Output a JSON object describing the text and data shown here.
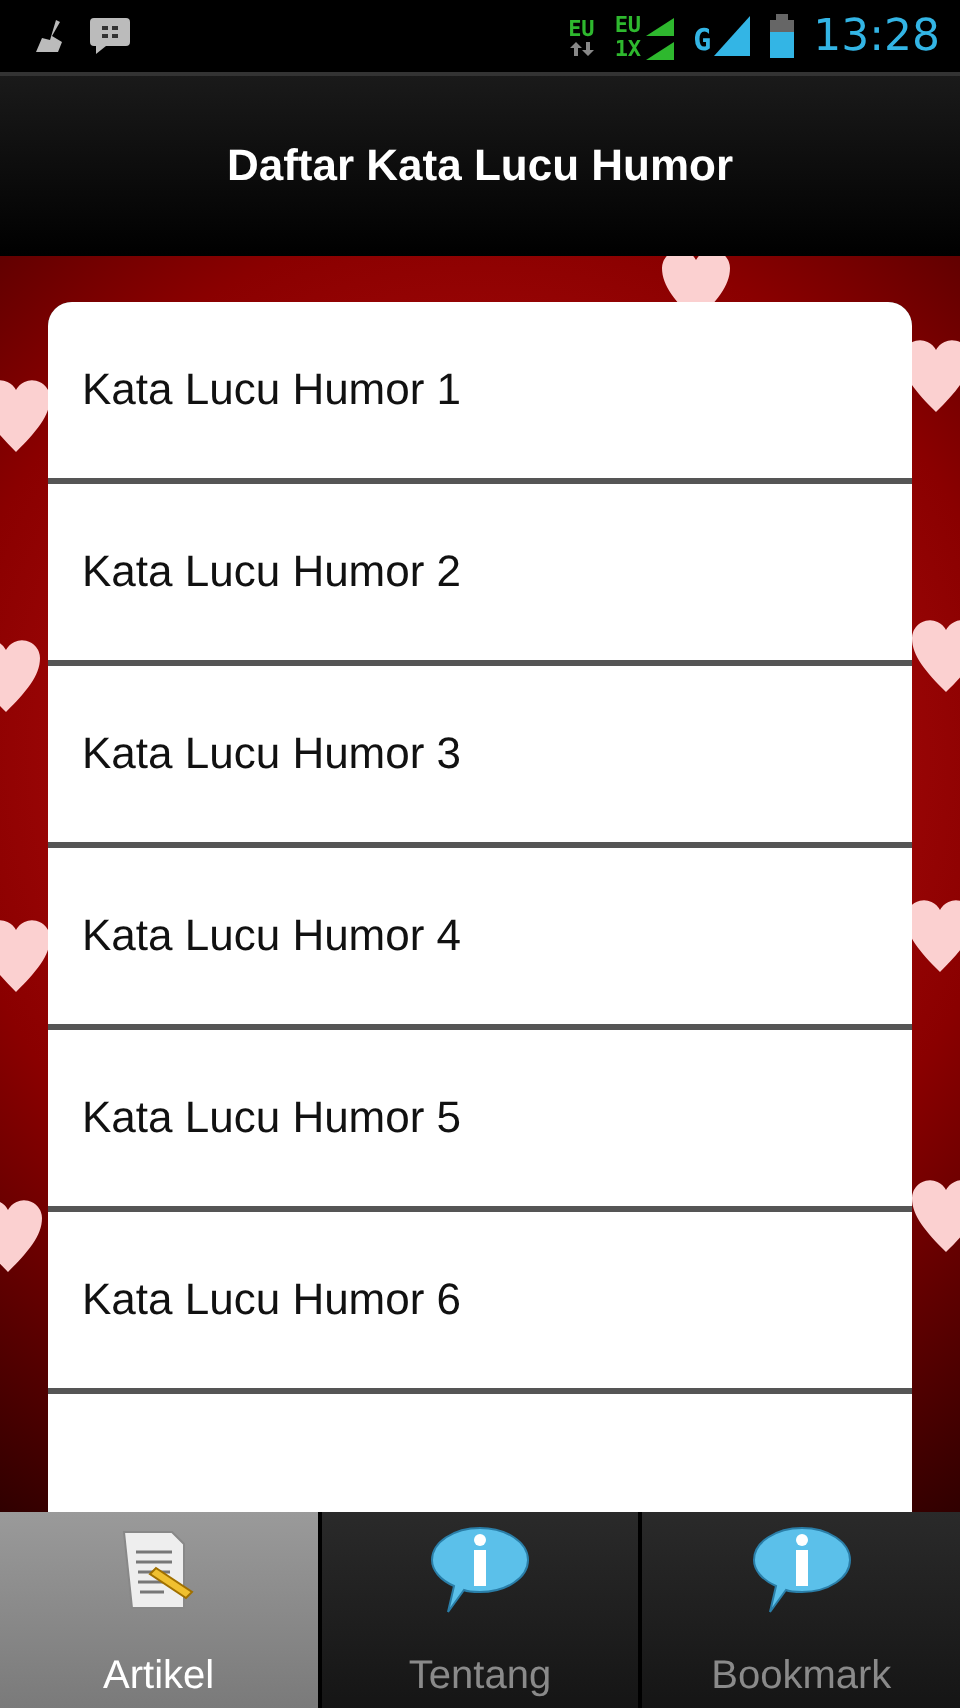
{
  "status_bar": {
    "network_labels": [
      "EU",
      "EU",
      "1X",
      "G"
    ],
    "time": "13:28"
  },
  "title": "Daftar Kata Lucu Humor",
  "items": [
    {
      "label": "Kata Lucu Humor 1"
    },
    {
      "label": "Kata Lucu Humor 2"
    },
    {
      "label": "Kata Lucu Humor 3"
    },
    {
      "label": "Kata Lucu Humor 4"
    },
    {
      "label": "Kata Lucu Humor 5"
    },
    {
      "label": "Kata Lucu Humor 6"
    }
  ],
  "partial_row": true,
  "tabs": [
    {
      "label": "Artikel",
      "kind": "article",
      "selected": true
    },
    {
      "label": "Tentang",
      "kind": "info",
      "selected": false
    },
    {
      "label": "Bookmark",
      "kind": "info",
      "selected": false
    }
  ]
}
